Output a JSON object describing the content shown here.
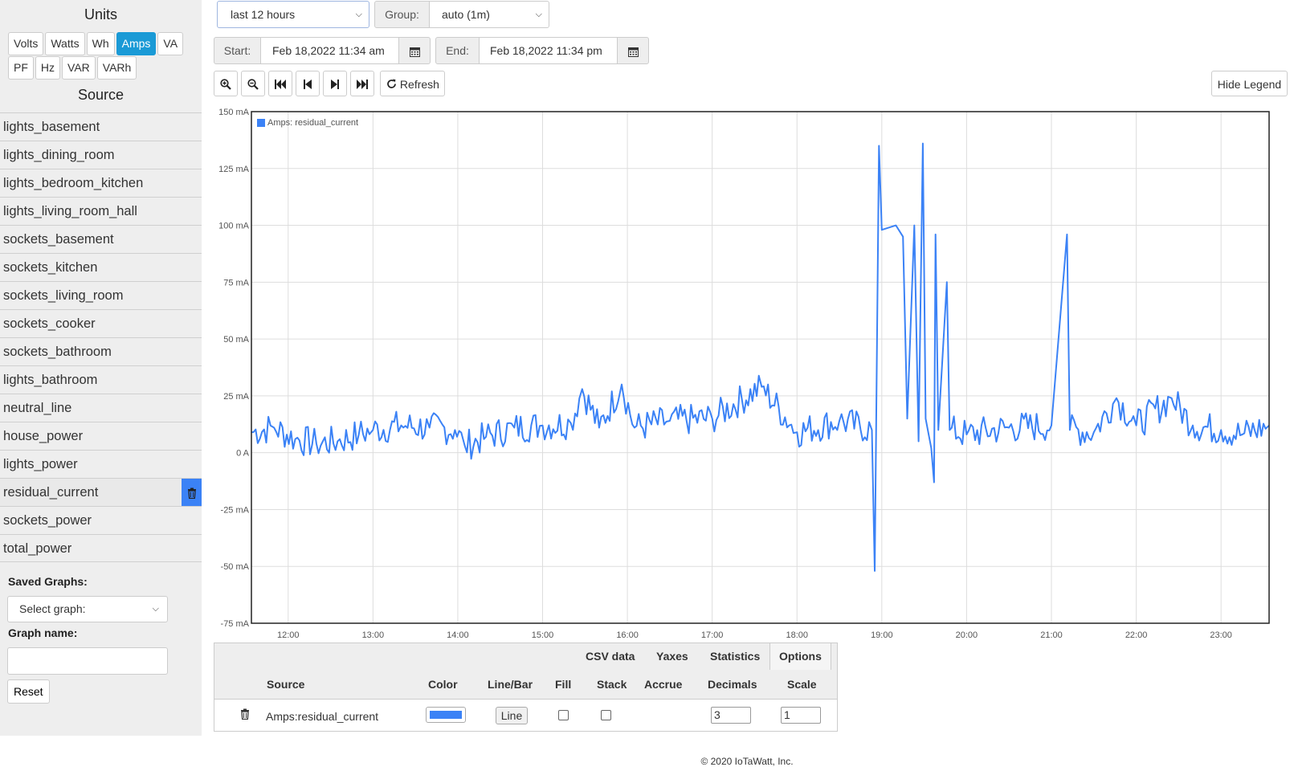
{
  "sidebar": {
    "units_title": "Units",
    "units_row1": [
      "Volts",
      "Watts",
      "Wh",
      "Amps",
      "VA"
    ],
    "units_row2": [
      "PF",
      "Hz",
      "VAR",
      "VARh"
    ],
    "active_unit": "Amps",
    "source_title": "Source",
    "sources": [
      "lights_basement",
      "lights_dining_room",
      "lights_bedroom_kitchen",
      "lights_living_room_hall",
      "sockets_basement",
      "sockets_kitchen",
      "sockets_living_room",
      "sockets_cooker",
      "sockets_bathroom",
      "lights_bathroom",
      "neutral_line",
      "house_power",
      "lights_power",
      "residual_current",
      "sockets_power",
      "total_power"
    ],
    "selected_source": "residual_current",
    "saved_graphs_label": "Saved Graphs:",
    "select_graph_placeholder": "Select graph:",
    "graph_name_label": "Graph name:",
    "graph_name_value": "",
    "reset_label": "Reset"
  },
  "controls": {
    "range": "last 12 hours",
    "group_label": "Group:",
    "group_value": "auto (1m)",
    "start_label": "Start:",
    "start_value": "Feb 18,2022 11:34 am",
    "end_label": "End:",
    "end_value": "Feb 18,2022 11:34 pm",
    "refresh_label": "Refresh",
    "hide_legend_label": "Hide Legend"
  },
  "icons": {
    "zoom_in": "zoom-in-icon",
    "zoom_out": "zoom-out-icon",
    "skip_start": "skip-to-start-icon",
    "step_back": "step-back-icon",
    "step_forward": "step-forward-icon",
    "skip_end": "skip-to-end-icon",
    "refresh": "refresh-icon",
    "calendar": "calendar-icon",
    "trash": "trash-icon"
  },
  "colors": {
    "accent": "#1a9ad6",
    "series": "#3b82f6"
  },
  "chart_data": {
    "type": "line",
    "legend": "Amps: residual_current",
    "legend_position": "top-left",
    "grid": true,
    "x_tick_labels": [
      "12:00",
      "13:00",
      "14:00",
      "15:00",
      "16:00",
      "17:00",
      "18:00",
      "19:00",
      "20:00",
      "21:00",
      "22:00",
      "23:00"
    ],
    "y_tick_values": [
      150,
      125,
      100,
      75,
      50,
      25,
      0,
      -25,
      -50,
      -75
    ],
    "y_tick_labels": [
      "150 mA",
      "125 mA",
      "100 mA",
      "75 mA",
      "50 mA",
      "25 mA",
      "0 A",
      "-25 mA",
      "-50 mA",
      "-75 mA"
    ],
    "ylim": [
      -75,
      150
    ],
    "xlim": [
      "11:34",
      "23:34"
    ],
    "series": [
      {
        "name": "Amps: residual_current",
        "baseline_range_mA": [
          0,
          15
        ],
        "points": [
          [
            "11:34",
            9
          ],
          [
            "11:50",
            11
          ],
          [
            "12:05",
            6
          ],
          [
            "12:20",
            4
          ],
          [
            "12:35",
            5
          ],
          [
            "12:50",
            8
          ],
          [
            "13:00",
            10
          ],
          [
            "13:20",
            12
          ],
          [
            "13:40",
            11
          ],
          [
            "13:58",
            10
          ],
          [
            "14:05",
            3
          ],
          [
            "14:20",
            7
          ],
          [
            "14:40",
            11
          ],
          [
            "15:00",
            12
          ],
          [
            "15:20",
            13
          ],
          [
            "15:28",
            28
          ],
          [
            "15:40",
            11
          ],
          [
            "15:56",
            30
          ],
          [
            "16:05",
            11
          ],
          [
            "16:30",
            14
          ],
          [
            "17:00",
            15
          ],
          [
            "17:35",
            29
          ],
          [
            "18:00",
            9
          ],
          [
            "18:30",
            14
          ],
          [
            "18:53",
            10
          ],
          [
            "18:55",
            -52
          ],
          [
            "18:58",
            135
          ],
          [
            "19:00",
            98
          ],
          [
            "19:10",
            100
          ],
          [
            "19:15",
            95
          ],
          [
            "19:18",
            15
          ],
          [
            "19:23",
            100
          ],
          [
            "19:26",
            5
          ],
          [
            "19:29",
            136
          ],
          [
            "19:31",
            15
          ],
          [
            "19:35",
            2
          ],
          [
            "19:37",
            -13
          ],
          [
            "19:38",
            96
          ],
          [
            "19:40",
            10
          ],
          [
            "19:46",
            75
          ],
          [
            "19:48",
            10
          ],
          [
            "20:00",
            8
          ],
          [
            "20:30",
            11
          ],
          [
            "21:00",
            12
          ],
          [
            "21:11",
            96
          ],
          [
            "21:13",
            10
          ],
          [
            "21:30",
            9
          ],
          [
            "21:46",
            24
          ],
          [
            "22:00",
            12
          ],
          [
            "22:25",
            24
          ],
          [
            "22:40",
            12
          ],
          [
            "23:00",
            10
          ],
          [
            "23:15",
            8
          ],
          [
            "23:34",
            12
          ]
        ]
      }
    ]
  },
  "table": {
    "tabs": [
      "CSV data",
      "Yaxes",
      "Statistics",
      "Options"
    ],
    "active_tab": "Options",
    "headers": [
      "Source",
      "Color",
      "Line/Bar",
      "Fill",
      "Stack",
      "Accrue",
      "Decimals",
      "Scale"
    ],
    "row": {
      "source": "Amps:residual_current",
      "color": "#3b82f6",
      "line_bar": "Line",
      "fill": false,
      "stack": false,
      "decimals": "3",
      "scale": "1"
    }
  },
  "footer": "© 2020 IoTaWatt, Inc."
}
